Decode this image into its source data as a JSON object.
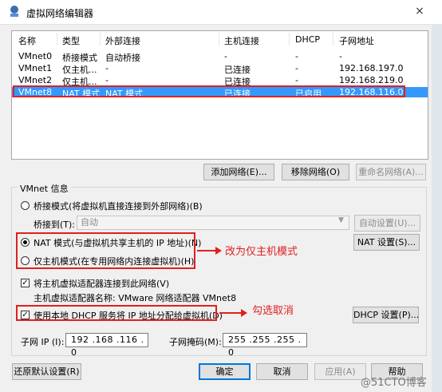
{
  "window": {
    "title": "虚拟网络编辑器",
    "close_label": "×"
  },
  "table": {
    "headers": [
      "名称",
      "类型",
      "外部连接",
      "主机连接",
      "DHCP",
      "子网地址"
    ],
    "rows": [
      [
        "VMnet0",
        "桥接模式",
        "自动桥接",
        "-",
        "-",
        "-"
      ],
      [
        "VMnet1",
        "仅主机...",
        "-",
        "已连接",
        "-",
        "192.168.197.0"
      ],
      [
        "VMnet2",
        "仅主机...",
        "-",
        "已连接",
        "-",
        "192.168.219.0"
      ],
      [
        "VMnet8",
        "NAT 模式",
        "NAT 模式",
        "已连接",
        "已启用",
        "192.168.116.0"
      ]
    ]
  },
  "list_buttons": {
    "add": "添加网络(E)...",
    "remove": "移除网络(O)",
    "rename": "重命名网络(A)..."
  },
  "vmnet_info": {
    "title": "VMnet 信息",
    "bridge_label": "桥接模式(将虚拟机直接连接到外部网络)(B)",
    "bridged_to_label": "桥接到(T):",
    "bridged_to_value": "自动",
    "auto_settings": "自动设置(U)...",
    "nat_label": "NAT 模式(与虚拟机共享主机的 IP 地址)(N)",
    "nat_settings": "NAT 设置(S)...",
    "hostonly_label": "仅主机模式(在专用网络内连接虚拟机)(H)",
    "connect_adapter_label": "将主机虚拟适配器连接到此网络(V)",
    "adapter_name_text": "主机虚拟适配器名称: VMware 网络适配器 VMnet8",
    "dhcp_label": "使用本地 DHCP 服务将 IP 地址分配给虚拟机(D)",
    "dhcp_settings": "DHCP 设置(P)...",
    "subnet_ip_label": "子网 IP (I):",
    "subnet_ip_value": "192 .168 .116 . 0",
    "subnet_mask_label": "子网掩码(M):",
    "subnet_mask_value": "255 .255 .255 . 0"
  },
  "annotations": {
    "change_mode": "改为仅主机模式",
    "uncheck": "勾选取消"
  },
  "footer": {
    "restore": "还原默认设置(R)",
    "ok": "确定",
    "cancel": "取消",
    "apply": "应用(A)",
    "help": "帮助"
  },
  "watermark": "@51CTO博客",
  "colors": {
    "selection": "#3399ff",
    "annotation": "#e02020"
  }
}
